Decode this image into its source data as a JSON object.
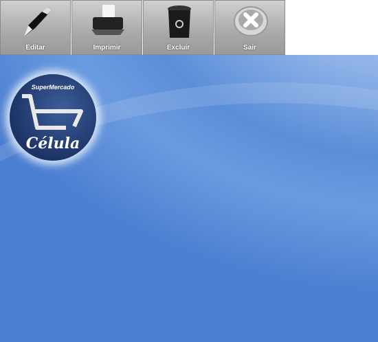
{
  "toolbar": {
    "buttons": [
      {
        "label": "Editar",
        "icon": "pen-icon"
      },
      {
        "label": "Imprimir",
        "icon": "printer-icon"
      },
      {
        "label": "Excluir",
        "icon": "trash-icon"
      },
      {
        "label": "Sair",
        "icon": "close-icon"
      }
    ]
  },
  "logo": {
    "line1": "SuperMercado",
    "line2": "Célula"
  }
}
